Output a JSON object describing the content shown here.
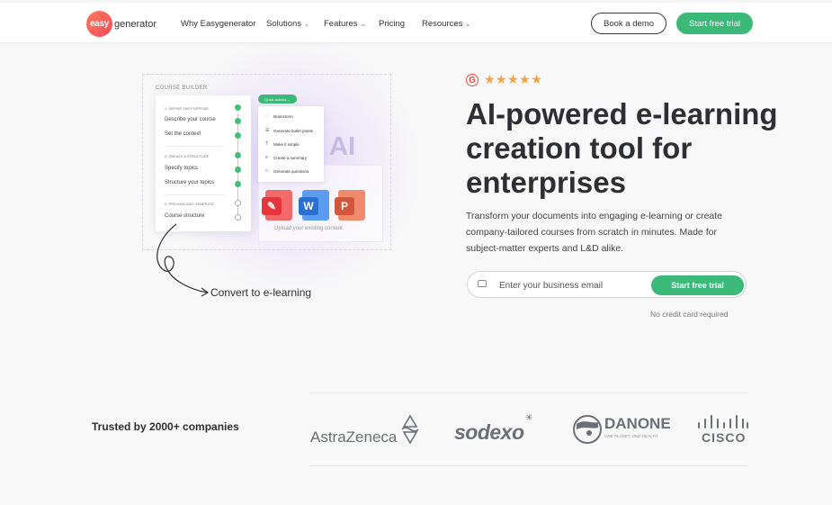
{
  "header": {
    "logo_badge": "easy",
    "logo_text": "generator",
    "nav": [
      {
        "label": "Why Easygenerator",
        "has_dropdown": false
      },
      {
        "label": "Solutions",
        "has_dropdown": true
      },
      {
        "label": "Features",
        "has_dropdown": true
      },
      {
        "label": "Pricing",
        "has_dropdown": false
      },
      {
        "label": "Resources",
        "has_dropdown": true
      }
    ],
    "book_demo": "Book a demo",
    "start_trial": "Start free trial"
  },
  "illustration": {
    "builder_title": "COURSE BUILDER",
    "sections": [
      {
        "title": "1. DEFINE THE PURPOSE",
        "items": [
          "Describe your course",
          "Set the context"
        ]
      },
      {
        "title": "2. CREATE A STRUCTURE",
        "items": [
          "Specify topics",
          "Structure your topics"
        ]
      },
      {
        "title": "3. PREVIEW AND GENERATE",
        "items": [
          "Course structure"
        ]
      }
    ],
    "ai_button": "Quick actions ⌄",
    "ai_menu": [
      {
        "icon": "bulb-icon",
        "label": "Brainstorm"
      },
      {
        "icon": "list-icon",
        "label": "Generate bullet points"
      },
      {
        "icon": "text-icon",
        "label": "Make it simple"
      },
      {
        "icon": "summary-icon",
        "label": "Create a summary"
      },
      {
        "icon": "question-icon",
        "label": "Generate questions"
      }
    ],
    "ai_big": "AI",
    "file_icons": [
      {
        "name": "pdf-icon",
        "letter": "",
        "color": "#e8343b"
      },
      {
        "name": "word-icon",
        "letter": "W",
        "color": "#2a6fd4"
      },
      {
        "name": "powerpoint-icon",
        "letter": "P",
        "color": "#d4553a"
      }
    ],
    "upload_text": "Upload your existing content",
    "convert_text": "Convert to e-learning"
  },
  "hero": {
    "rating_badge": "G",
    "stars": "★★★★★",
    "title": "AI-powered e-learning creation tool for enterprises",
    "subtitle": "Transform your documents into engaging e-learning or create company-tailored courses from scratch in minutes. Made for subject-matter experts and L&D alike.",
    "email_placeholder": "Enter your business email",
    "email_value": "",
    "cta": "Start free trial",
    "note": "No credit card required"
  },
  "trusted": {
    "title": "Trusted by 2000+ companies",
    "logos": [
      {
        "name": "AstraZeneca",
        "text": "AstraZeneca"
      },
      {
        "name": "Sodexo",
        "text": "sodexo"
      },
      {
        "name": "Danone",
        "text": "DANONE",
        "tagline": "ONE PLANET. ONE HEALTH"
      },
      {
        "name": "Cisco",
        "text": "CISCO"
      }
    ]
  },
  "colors": {
    "accent": "#3bb979",
    "brand": "#f54b5e",
    "star": "#f5a142"
  }
}
